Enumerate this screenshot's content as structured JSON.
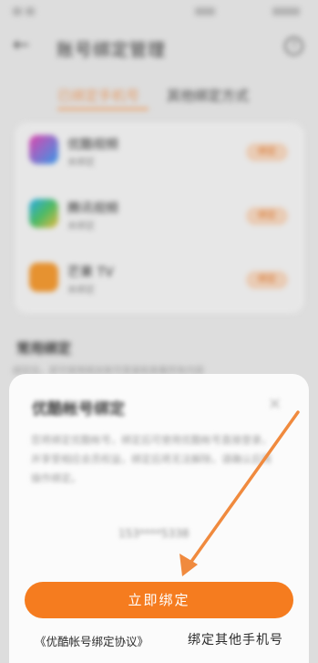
{
  "header": {
    "title": "账号绑定管理",
    "help_glyph": "?",
    "back_glyph": "←"
  },
  "tabs": [
    {
      "label": "已绑定手机号"
    },
    {
      "label": "其他绑定方式"
    }
  ],
  "apps": [
    {
      "name": "优酷视频",
      "status": "未绑定",
      "action": "绑定",
      "icon": "youku-icon",
      "color": "#2bb3f5"
    },
    {
      "name": "腾讯视频",
      "status": "未绑定",
      "action": "绑定",
      "icon": "tencent-video-icon",
      "color": "#3fb76b"
    },
    {
      "name": "芒果 TV",
      "status": "未绑定",
      "action": "绑定",
      "icon": "mango-tv-icon",
      "color": "#f39a33"
    }
  ],
  "section": {
    "title": "常用绑定",
    "desc": "绑定后，即可使用相关账号登录和查看所有内容"
  },
  "dialog": {
    "title": "优酷帐号绑定",
    "close_glyph": "×",
    "desc": "您将绑定优酷帐号，绑定后可使用优酷帐号直接登录，并享受相应会员权益，绑定后将无法解除，请确认后再操作绑定。",
    "phone": "153****5338",
    "primary_button": "立即绑定",
    "agreement_link": "《优酷帐号绑定协议》",
    "other_phone_link": "绑定其他手机号"
  },
  "colors": {
    "accent": "#f57c1f",
    "arrow": "#f08a3e"
  }
}
